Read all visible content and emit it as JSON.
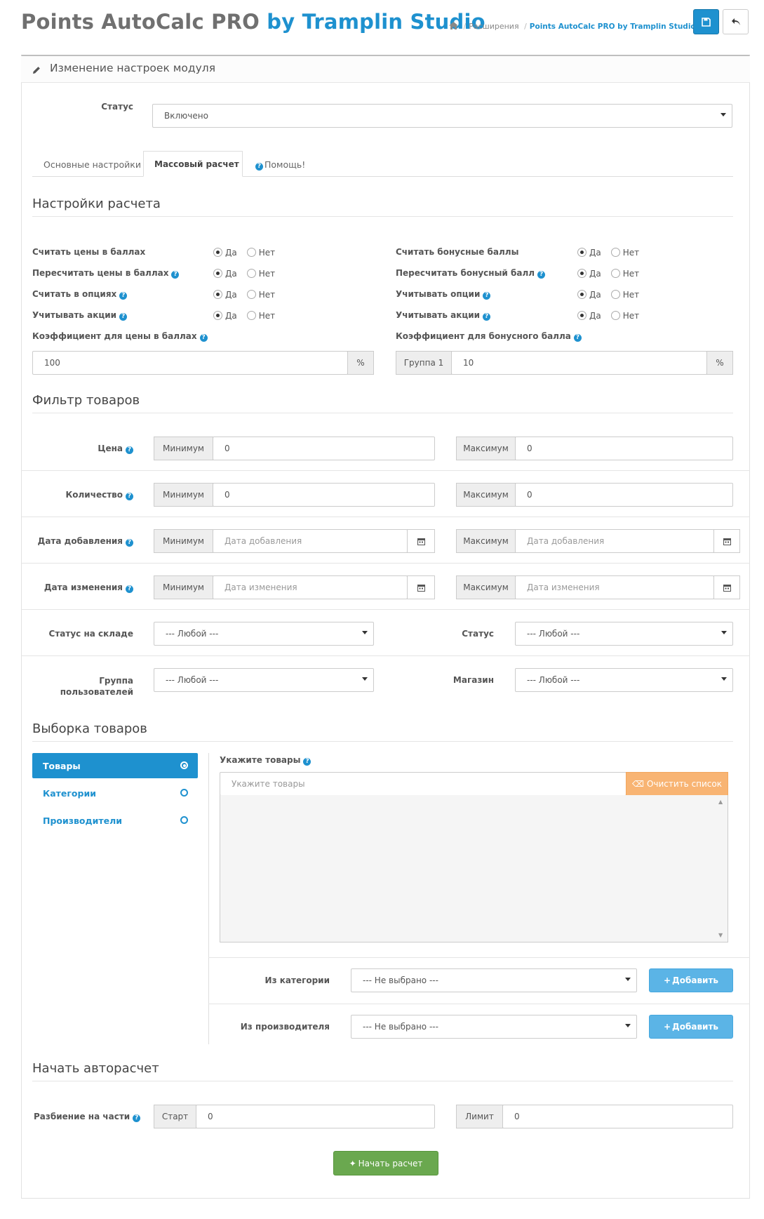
{
  "header": {
    "title_prefix": "Points AutoCalc PRO",
    "title_suffix": "by Tramplin Studio",
    "breadcrumb": {
      "item1": "Расширения",
      "current": "Points AutoCalc PRO by Tramplin Studio"
    },
    "save_icon": "save-icon",
    "back_icon": "reply-icon"
  },
  "panel": {
    "title": "Изменение настроек модуля"
  },
  "status": {
    "label": "Статус",
    "value": "Включено"
  },
  "tabs": [
    {
      "label": "Основные настройки",
      "active": false
    },
    {
      "label": "Массовый расчет",
      "active": true
    },
    {
      "label": "Помощь!",
      "active": false
    }
  ],
  "calc": {
    "section": "Настройки расчета",
    "yes": "Да",
    "no": "Нет",
    "left": [
      {
        "label": "Считать цены в баллах",
        "help": false,
        "value": "yes"
      },
      {
        "label": "Пересчитать цены в баллах",
        "help": true,
        "value": "yes"
      },
      {
        "label": "Считать в опциях",
        "help": true,
        "value": "yes"
      },
      {
        "label": "Учитывать акции",
        "help": true,
        "value": "yes"
      }
    ],
    "right": [
      {
        "label": "Считать бонусные баллы",
        "help": false,
        "value": "yes"
      },
      {
        "label": "Пересчитать бонусный балл",
        "help": true,
        "value": "yes"
      },
      {
        "label": "Учитывать опции",
        "help": true,
        "value": "yes"
      },
      {
        "label": "Учитывать акции",
        "help": true,
        "value": "yes"
      }
    ],
    "coef_price_label": "Коэффициент для цены в баллах",
    "coef_price_value": "100",
    "coef_bonus_label": "Коэффициент для бонусного балла",
    "group_label": "Группа 1",
    "coef_bonus_value": "10",
    "percent": "%"
  },
  "filter": {
    "section": "Фильтр товаров",
    "min": "Минимум",
    "max": "Максимум",
    "price_label": "Цена",
    "price_min": "0",
    "price_max": "0",
    "qty_label": "Количество",
    "qty_min": "0",
    "qty_max": "0",
    "date_added_label": "Дата добавления",
    "date_added_placeholder": "Дата добавления",
    "date_modified_label": "Дата изменения",
    "date_modified_placeholder": "Дата изменения",
    "stock_label": "Статус на складе",
    "stock_value": "--- Любой ---",
    "status_label": "Статус",
    "status_value": "--- Любой ---",
    "group_label_1": "Группа",
    "group_label_2": "пользователей",
    "group_value": "--- Любой ---",
    "store_label": "Магазин",
    "store_value": "--- Любой ---"
  },
  "selection": {
    "section": "Выборка товаров",
    "nav": [
      {
        "label": "Товары",
        "active": true
      },
      {
        "label": "Категории",
        "active": false
      },
      {
        "label": "Производители",
        "active": false
      }
    ],
    "products_label": "Укажите товары",
    "products_placeholder": "Укажите товары",
    "clear_button": "Очистить список",
    "from_category_label": "Из категории",
    "from_category_value": "--- Не выбрано ---",
    "from_manufacturer_label": "Из производителя",
    "from_manufacturer_value": "--- Не выбрано ---",
    "add_button": "Добавить"
  },
  "start": {
    "section": "Начать авторасчет",
    "split_label": "Разбиение на части",
    "start_label": "Старт",
    "start_value": "0",
    "limit_label": "Лимит",
    "limit_value": "0",
    "run_button": "Начать расчет"
  }
}
